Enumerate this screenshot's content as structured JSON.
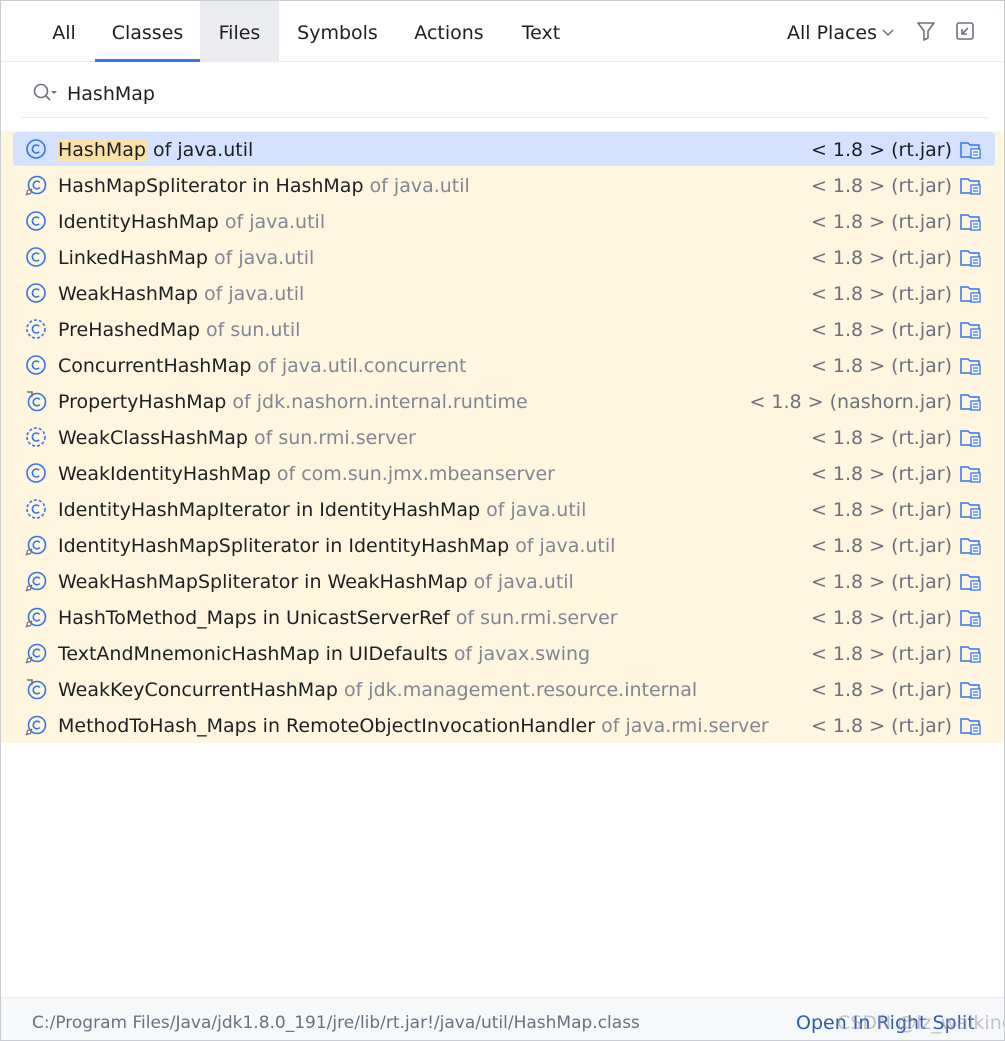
{
  "tabs": [
    {
      "label": "All"
    },
    {
      "label": "Classes"
    },
    {
      "label": "Files"
    },
    {
      "label": "Symbols"
    },
    {
      "label": "Actions"
    },
    {
      "label": "Text"
    }
  ],
  "active_tab": "Classes",
  "scope": {
    "label": "All Places"
  },
  "search": {
    "value": "HashMap",
    "placeholder": ""
  },
  "colors": {
    "accent": "#3574f0",
    "selection": "#d4e2ff",
    "match_bg": "#fef6de",
    "highlight": "#fbe0a8",
    "icon": "#3574f0"
  },
  "results": [
    {
      "name_match": "HashMap",
      "name_rest": "",
      "container": "",
      "context": "of java.util",
      "location": "< 1.8 > (rt.jar)",
      "icon": "class-icon",
      "selected": true
    },
    {
      "name_match": "",
      "name_rest": "HashMapSpliterator",
      "container": " in HashMap",
      "context": "of java.util",
      "location": "< 1.8 > (rt.jar)",
      "icon": "nested-class-icon",
      "selected": false
    },
    {
      "name_match": "",
      "name_rest": "IdentityHashMap",
      "container": "",
      "context": "of java.util",
      "location": "< 1.8 > (rt.jar)",
      "icon": "class-icon",
      "selected": false
    },
    {
      "name_match": "",
      "name_rest": "LinkedHashMap",
      "container": "",
      "context": "of java.util",
      "location": "< 1.8 > (rt.jar)",
      "icon": "class-icon",
      "selected": false
    },
    {
      "name_match": "",
      "name_rest": "WeakHashMap",
      "container": "",
      "context": "of java.util",
      "location": "< 1.8 > (rt.jar)",
      "icon": "class-icon",
      "selected": false
    },
    {
      "name_match": "",
      "name_rest": "PreHashedMap",
      "container": "",
      "context": "of sun.util",
      "location": "< 1.8 > (rt.jar)",
      "icon": "abstract-class-icon",
      "selected": false
    },
    {
      "name_match": "",
      "name_rest": "ConcurrentHashMap",
      "container": "",
      "context": "of java.util.concurrent",
      "location": "< 1.8 > (rt.jar)",
      "icon": "class-icon",
      "selected": false
    },
    {
      "name_match": "",
      "name_rest": "PropertyHashMap",
      "container": "",
      "context": "of jdk.nashorn.internal.runtime",
      "location": "< 1.8 > (nashorn.jar)",
      "icon": "final-class-icon",
      "selected": false
    },
    {
      "name_match": "",
      "name_rest": "WeakClassHashMap",
      "container": "",
      "context": "of sun.rmi.server",
      "location": "< 1.8 > (rt.jar)",
      "icon": "abstract-class-icon",
      "selected": false
    },
    {
      "name_match": "",
      "name_rest": "WeakIdentityHashMap",
      "container": "",
      "context": "of com.sun.jmx.mbeanserver",
      "location": "< 1.8 > (rt.jar)",
      "icon": "class-icon",
      "selected": false
    },
    {
      "name_match": "",
      "name_rest": "IdentityHashMapIterator",
      "container": " in IdentityHashMap",
      "context": "of java.util",
      "location": "< 1.8 > (rt.jar)",
      "icon": "abstract-class-icon",
      "selected": false
    },
    {
      "name_match": "",
      "name_rest": "IdentityHashMapSpliterator",
      "container": " in IdentityHashMap",
      "context": "of java.util",
      "location": "< 1.8 > (rt.jar)",
      "icon": "nested-class-icon",
      "selected": false
    },
    {
      "name_match": "",
      "name_rest": "WeakHashMapSpliterator",
      "container": " in WeakHashMap",
      "context": "of java.util",
      "location": "< 1.8 > (rt.jar)",
      "icon": "nested-class-icon",
      "selected": false
    },
    {
      "name_match": "",
      "name_rest": "HashToMethod_Maps",
      "container": " in UnicastServerRef",
      "context": "of sun.rmi.server",
      "location": "< 1.8 > (rt.jar)",
      "icon": "nested-class-icon",
      "selected": false
    },
    {
      "name_match": "",
      "name_rest": "TextAndMnemonicHashMap",
      "container": " in UIDefaults",
      "context": "of javax.swing",
      "location": "< 1.8 > (rt.jar)",
      "icon": "nested-class-icon",
      "selected": false
    },
    {
      "name_match": "",
      "name_rest": "WeakKeyConcurrentHashMap",
      "container": "",
      "context": "of jdk.management.resource.internal",
      "location": "< 1.8 > (rt.jar)",
      "icon": "final-class-icon",
      "selected": false
    },
    {
      "name_match": "",
      "name_rest": "MethodToHash_Maps",
      "container": " in RemoteObjectInvocationHandler",
      "context": "of java.rmi.server",
      "location": "< 1.8 > (rt.jar)",
      "icon": "nested-class-icon",
      "selected": false
    }
  ],
  "status": {
    "path": "C:/Program Files/Java/jdk1.8.0_191/jre/lib/rt.jar!/java/util/HashMap.class",
    "action": "Open In Right Split",
    "watermark": "CSDN @lz_walking"
  }
}
